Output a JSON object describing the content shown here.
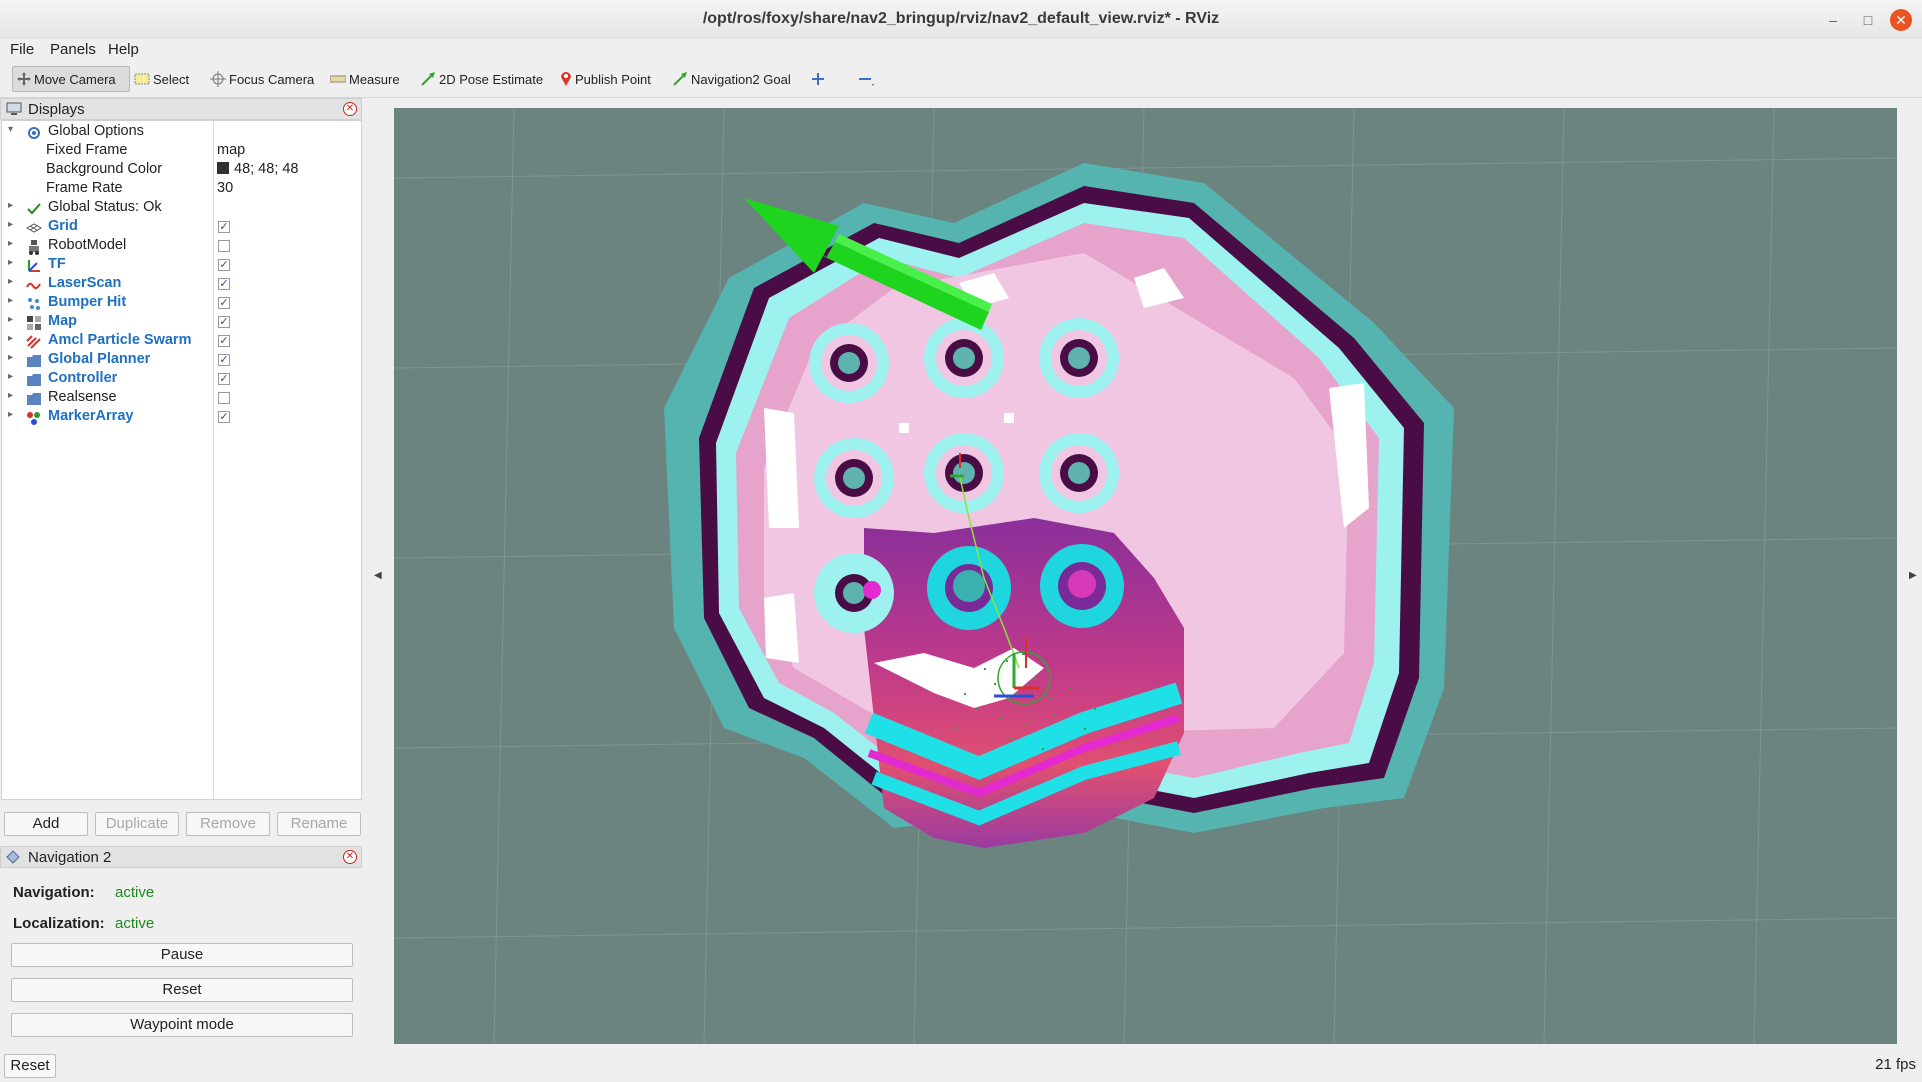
{
  "window": {
    "title": "/opt/ros/foxy/share/nav2_bringup/rviz/nav2_default_view.rviz* - RViz"
  },
  "menu": {
    "file": "File",
    "panels": "Panels",
    "help": "Help"
  },
  "toolbar": {
    "move_camera": "Move Camera",
    "select": "Select",
    "focus_camera": "Focus Camera",
    "measure": "Measure",
    "pose_estimate": "2D Pose Estimate",
    "publish_point": "Publish Point",
    "nav2_goal": "Navigation2 Goal"
  },
  "displays": {
    "title": "Displays",
    "global_options": "Global Options",
    "options": [
      {
        "label": "Fixed Frame",
        "value": "map"
      },
      {
        "label": "Background Color",
        "value": "48; 48; 48"
      },
      {
        "label": "Frame Rate",
        "value": "30"
      }
    ],
    "global_status": "Global Status: Ok",
    "items": [
      {
        "label": "Grid",
        "checked": true,
        "enabled": true
      },
      {
        "label": "RobotModel",
        "checked": false,
        "enabled": false
      },
      {
        "label": "TF",
        "checked": true,
        "enabled": true
      },
      {
        "label": "LaserScan",
        "checked": true,
        "enabled": true
      },
      {
        "label": "Bumper Hit",
        "checked": true,
        "enabled": true
      },
      {
        "label": "Map",
        "checked": true,
        "enabled": true
      },
      {
        "label": "Amcl Particle Swarm",
        "checked": true,
        "enabled": true
      },
      {
        "label": "Global Planner",
        "checked": true,
        "enabled": true
      },
      {
        "label": "Controller",
        "checked": true,
        "enabled": true
      },
      {
        "label": "Realsense",
        "checked": false,
        "enabled": false
      },
      {
        "label": "MarkerArray",
        "checked": true,
        "enabled": true
      }
    ],
    "buttons": {
      "add": "Add",
      "duplicate": "Duplicate",
      "remove": "Remove",
      "rename": "Rename"
    }
  },
  "navigation": {
    "title": "Navigation 2",
    "navigation_label": "Navigation:",
    "navigation_value": "active",
    "localization_label": "Localization:",
    "localization_value": "active",
    "pause": "Pause",
    "reset": "Reset",
    "waypoint_mode": "Waypoint mode"
  },
  "status": {
    "reset": "Reset",
    "fps": "21 fps"
  }
}
